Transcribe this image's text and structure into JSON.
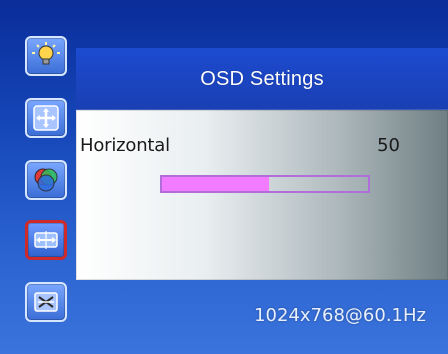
{
  "osd": {
    "title": "OSD Settings",
    "setting": {
      "label": "Horizontal",
      "value": "50",
      "progress_fraction": 0.52
    },
    "status": {
      "resolution": "1024x768@60.1Hz"
    }
  },
  "sidebar": {
    "items": [
      {
        "icon": "brightness-bulb-icon",
        "selected": false
      },
      {
        "icon": "position-arrows-icon",
        "selected": false
      },
      {
        "icon": "color-balls-icon",
        "selected": false
      },
      {
        "icon": "osd-settings-icon",
        "selected": true
      },
      {
        "icon": "reset-icon",
        "selected": false
      }
    ]
  },
  "colors": {
    "background_blue": "#1546b8",
    "header_blue": "#1c4bd0",
    "selection_red": "#cf2a2a",
    "progress_fill": "#f27bff",
    "progress_border": "#b06fd8"
  }
}
